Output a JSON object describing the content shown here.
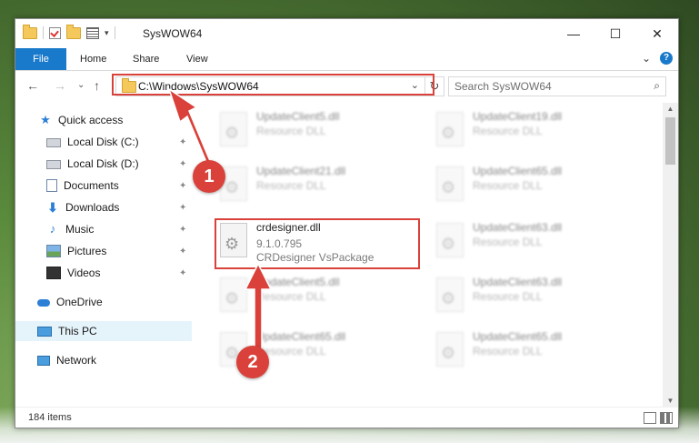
{
  "window": {
    "title": "SysWOW64",
    "controls": {
      "minimize": "—",
      "maximize": "☐",
      "close": "✕"
    }
  },
  "ribbon": {
    "tabs": [
      "File",
      "Home",
      "Share",
      "View"
    ],
    "collapse_glyph": "⌄",
    "help_glyph": "?"
  },
  "address": {
    "path": "C:\\Windows\\SysWOW64",
    "chevron": "⌄",
    "refresh": "↻"
  },
  "search": {
    "placeholder": "Search SysWOW64",
    "icon": "search-icon"
  },
  "nav": {
    "back": "←",
    "forward": "→",
    "recent": "⌄",
    "up": "↑"
  },
  "sidebar": {
    "items": [
      {
        "label": "Quick access",
        "icon": "star-icon",
        "pinned": false
      },
      {
        "label": "Local Disk (C:)",
        "icon": "disk-icon",
        "pinned": true
      },
      {
        "label": "Local Disk (D:)",
        "icon": "disk-icon",
        "pinned": true
      },
      {
        "label": "Documents",
        "icon": "documents-icon",
        "pinned": true
      },
      {
        "label": "Downloads",
        "icon": "downloads-icon",
        "pinned": true
      },
      {
        "label": "Music",
        "icon": "music-icon",
        "pinned": true
      },
      {
        "label": "Pictures",
        "icon": "pictures-icon",
        "pinned": true
      },
      {
        "label": "Videos",
        "icon": "videos-icon",
        "pinned": true
      },
      {
        "label": "OneDrive",
        "icon": "onedrive-icon",
        "pinned": false
      },
      {
        "label": "This PC",
        "icon": "this-pc-icon",
        "pinned": false,
        "selected": true
      },
      {
        "label": "Network",
        "icon": "network-icon",
        "pinned": false
      }
    ],
    "pin_glyph": "📌"
  },
  "files": {
    "background": [
      {
        "name": "UpdateClient5.dll",
        "type": "Resource DLL"
      },
      {
        "name": "UpdateClient19.dll",
        "type": "Resource DLL"
      },
      {
        "name": "UpdateClient21.dll",
        "type": "Resource DLL"
      },
      {
        "name": "UpdateClient65.dll",
        "type": "Resource DLL"
      },
      {
        "name": "UpdateClient63.dll",
        "type": "Resource DLL"
      },
      {
        "name": "UpdateClient5.dll",
        "type": "Resource DLL"
      },
      {
        "name": "UpdateClient63.dll",
        "type": "Resource DLL"
      },
      {
        "name": "UpdateClient65.dll",
        "type": "Resource DLL"
      },
      {
        "name": "UpdateClient65.dll",
        "type": "Resource DLL"
      }
    ],
    "target": {
      "name": "crdesigner.dll",
      "version": "9.1.0.795",
      "description": "CRDesigner VsPackage"
    }
  },
  "status": {
    "count": "184 items"
  },
  "annotations": {
    "step1": "1",
    "step2": "2",
    "color": "#d9413a"
  }
}
